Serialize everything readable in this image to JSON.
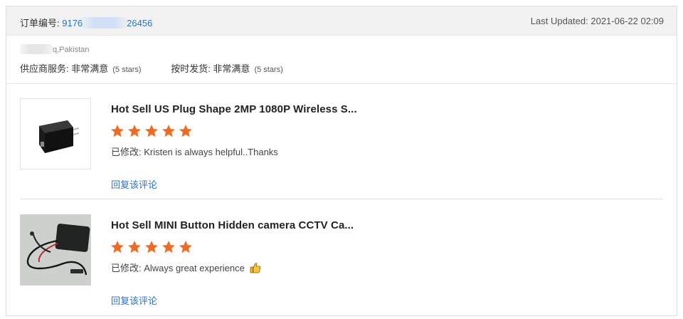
{
  "header": {
    "order_label": "订单编号: ",
    "order_prefix": "9176",
    "order_suffix": "26456",
    "last_updated": "Last Updated: 2021-06-22 02:09"
  },
  "seller": {
    "location": "q,Pakistan",
    "ratings": [
      {
        "label": "供应商服务: 非常满意",
        "note": "(5 stars)"
      },
      {
        "label": "按时发货: 非常满意",
        "note": "(5 stars)"
      }
    ]
  },
  "reviews": [
    {
      "title": "Hot Sell US Plug Shape 2MP 1080P Wireless S...",
      "rating": 5,
      "comment": "已修改: Kristen is always helpful..Thanks",
      "reply_label": "回复该评论",
      "image": "usb-charger-camera-image"
    },
    {
      "title": "Hot Sell MINI Button Hidden camera CCTV Ca...",
      "rating": 5,
      "comment": "已修改: Always great experience",
      "comment_icon": "thumbs-up-icon",
      "reply_label": "回复该评论",
      "image": "mini-button-camera-image"
    }
  ],
  "colors": {
    "link": "#2b73c8",
    "star": "#f26a21",
    "header_bg": "#f2f2f2"
  }
}
